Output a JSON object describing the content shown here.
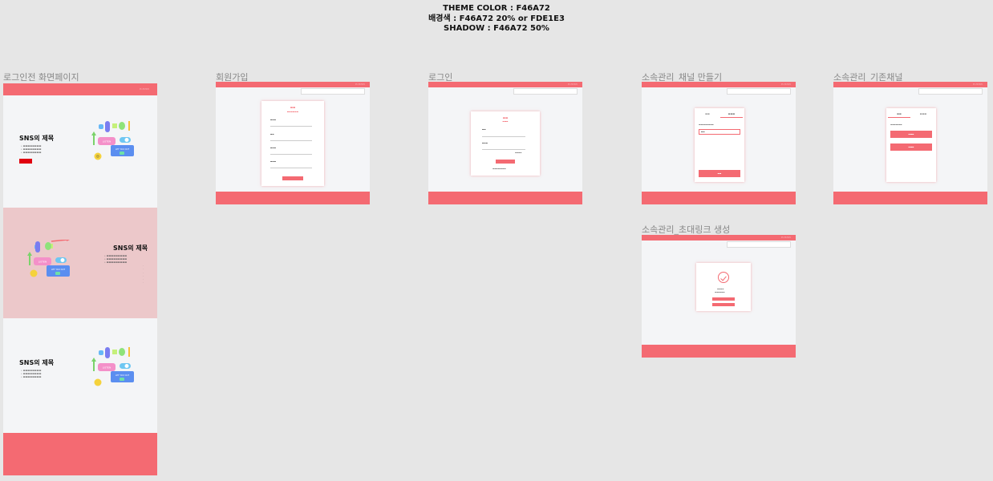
{
  "notes": {
    "theme_color": "THEME COLOR : F46A72",
    "background_color": "배경색 :  F46A72 20% or FDE1E3",
    "shadow": "SHADOW : F46A72 50%"
  },
  "colors": {
    "theme": "#F46A72",
    "background": "#FDE1E3"
  },
  "frames": {
    "landing": {
      "label": "로그인전 화면페이지"
    },
    "signup": {
      "label": "회원가입"
    },
    "login": {
      "label": "로그인"
    },
    "create_channel": {
      "label": "소속관리_채널 만들기"
    },
    "existing_channel": {
      "label": "소속관리_기존채널"
    },
    "invite_link": {
      "label": "소속관리_초대링크 생성"
    }
  },
  "landing": {
    "sections": [
      {
        "title": "SNS의 제목"
      },
      {
        "title": "SNS의 제목"
      },
      {
        "title": "SNS의 제목"
      }
    ],
    "illustration": {
      "badge_text": "LISTEN",
      "cta_text": "LET YOU OUT"
    }
  }
}
